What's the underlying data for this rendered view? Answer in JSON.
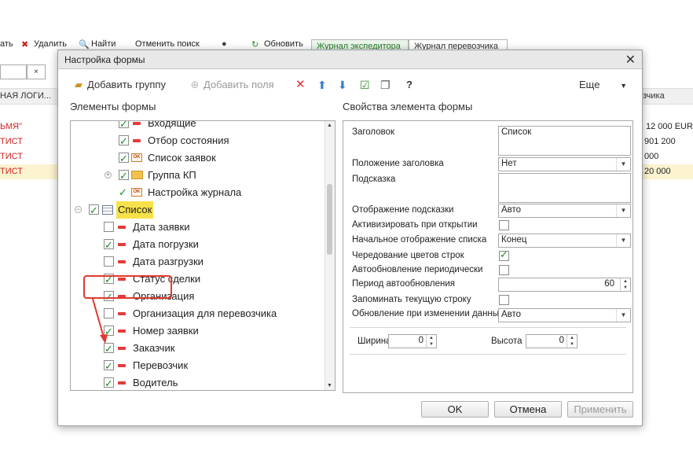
{
  "background": {
    "toolbar": {
      "cut_text": "ать",
      "delete": "Удалить",
      "find": "Найти",
      "cancel_search": "Отменить поиск",
      "refresh": "Обновить"
    },
    "tabs": [
      "Журнал экспедитора",
      "Журнал перевозчика"
    ],
    "header_left": "НАЯ ЛОГИ...",
    "header_right": "зчика",
    "rows": [
      {
        "left": "ЬМЯ\"",
        "right": "12 000  EUR"
      },
      {
        "left": "ТИСТ",
        "right": "901 200"
      },
      {
        "left": "ТИСТ",
        "right": "000"
      },
      {
        "left": "ТИСТ",
        "right": "20 000"
      }
    ]
  },
  "dialog": {
    "title": "Настройка формы",
    "toolbar": {
      "add_group": "Добавить группу",
      "add_fields": "Добавить поля",
      "help": "?",
      "more": "Еще"
    },
    "left_title": "Элементы формы",
    "right_title": "Свойства элемента формы",
    "tree": [
      {
        "label": "Входящие",
        "checked": true,
        "icon": "minus-icon",
        "level": 2
      },
      {
        "label": "Отбор состояния",
        "checked": true,
        "icon": "minus-icon",
        "level": 2
      },
      {
        "label": "Список заявок",
        "checked": true,
        "icon": "ok-icon",
        "level": 2
      },
      {
        "label": "Группа КП",
        "checked": true,
        "icon": "folder-icon",
        "level": 2,
        "expander": "+"
      },
      {
        "label": "Настройка журнала",
        "checked": true,
        "icon": "ok-icon",
        "level": 2
      },
      {
        "label": "Список",
        "checked": true,
        "icon": "table-icon",
        "level": 1,
        "expander": "−",
        "selected": true
      },
      {
        "label": "Дата заявки",
        "checked": false,
        "icon": "minus-icon",
        "level": 3
      },
      {
        "label": "Дата погрузки",
        "checked": true,
        "icon": "minus-icon",
        "level": 3
      },
      {
        "label": "Дата разгрузки",
        "checked": false,
        "icon": "minus-icon",
        "level": 3
      },
      {
        "label": "Статус сделки",
        "checked": true,
        "icon": "minus-icon",
        "level": 3
      },
      {
        "label": "Организация",
        "checked": true,
        "icon": "minus-icon",
        "level": 3
      },
      {
        "label": "Организация для перевозчика",
        "checked": false,
        "icon": "minus-icon",
        "level": 3
      },
      {
        "label": "Номер заявки",
        "checked": true,
        "icon": "minus-icon",
        "level": 3
      },
      {
        "label": "Заказчик",
        "checked": true,
        "icon": "minus-icon",
        "level": 3
      },
      {
        "label": "Перевозчик",
        "checked": true,
        "icon": "minus-icon",
        "level": 3
      },
      {
        "label": "Водитель",
        "checked": true,
        "icon": "minus-icon",
        "level": 3
      }
    ],
    "props": {
      "title_label": "Заголовок",
      "title_value": "Список",
      "title_pos_label": "Положение заголовка",
      "title_pos_value": "Нет",
      "hint_label": "Подсказка",
      "hint_value": "",
      "hint_display_label": "Отображение подсказки",
      "hint_display_value": "Авто",
      "activate_label": "Активизировать при открытии",
      "activate_checked": false,
      "initial_display_label": "Начальное отображение списка",
      "initial_display_value": "Конец",
      "alternate_label": "Чередование цветов строк",
      "alternate_checked": true,
      "autorefresh_label": "Автообновление периодически",
      "autorefresh_checked": false,
      "period_label": "Период автообновления",
      "period_value": "60",
      "remember_label": "Запоминать текущую строку",
      "remember_checked": false,
      "update_label": "Обновление при изменении данных",
      "update_value": "Авто",
      "width_label": "Ширина",
      "width_value": "0",
      "height_label": "Высота",
      "height_value": "0"
    },
    "buttons": {
      "ok": "OK",
      "cancel": "Отмена",
      "apply": "Применить"
    }
  },
  "colors": {
    "accent_red": "#e03a2f",
    "check_green": "#1a8a2a",
    "highlight": "#f7e14a"
  }
}
